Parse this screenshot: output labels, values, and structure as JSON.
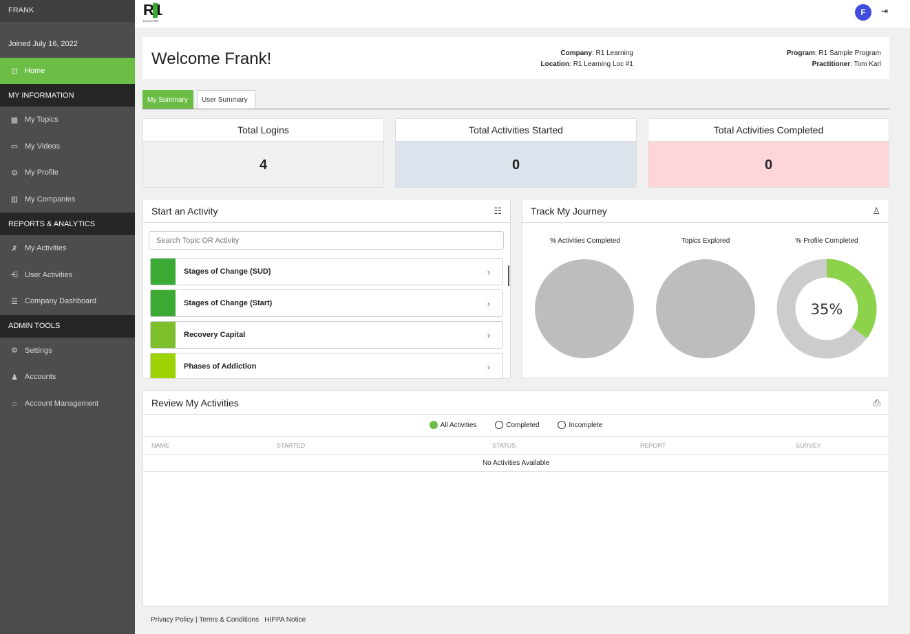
{
  "sidebar": {
    "user": "FRANK",
    "joined": "Joined July 16, 2022",
    "home": "Home",
    "sections": {
      "my_information": "MY INFORMATION",
      "reports": "REPORTS & ANALYTICS",
      "admin": "ADMIN TOOLS"
    },
    "items": {
      "my_topics": "My Topics",
      "my_videos": "My Videos",
      "my_profile": "My Profile",
      "my_companies": "My Companies",
      "my_activities": "My Activities",
      "user_activities": "User Activities",
      "company_dashboard": "Company Dashboard",
      "settings": "Settings",
      "accounts": "Accounts",
      "account_management": "Account Management"
    }
  },
  "topbar": {
    "logo_text": "R1",
    "logo_sub": "DISCOVER",
    "avatar_initial": "F"
  },
  "welcome": {
    "title": "Welcome Frank!",
    "company_label": "Company",
    "company_value": ": R1 Learning",
    "location_label": "Location",
    "location_value": ": R1 Learning Loc #1",
    "program_label": "Program",
    "program_value": ": R1 Sample Program",
    "practitioner_label": "Practitioner",
    "practitioner_value": ": Tom Karl"
  },
  "tabs": {
    "my_summary": "My Summary",
    "user_summary": "User Summary"
  },
  "stats": [
    {
      "title": "Total Logins",
      "value": "4",
      "bg": "#f0f0f0"
    },
    {
      "title": "Total Activities Started",
      "value": "0",
      "bg": "#dde3ec"
    },
    {
      "title": "Total Activities Completed",
      "value": "0",
      "bg": "#fdd5db"
    }
  ],
  "start_activity": {
    "title": "Start an Activity",
    "search_placeholder": "Search Topic OR Activity",
    "items": [
      {
        "name": "Stages of Change (SUD)",
        "color": "#3aaa35"
      },
      {
        "name": "Stages of Change (Start)",
        "color": "#3aaa35"
      },
      {
        "name": "Recovery Capital",
        "color": "#7dbf2a"
      },
      {
        "name": "Phases of Addiction",
        "color": "#9cd300"
      }
    ]
  },
  "journey": {
    "title": "Track My Journey",
    "labels": [
      "% Activities Completed",
      "Topics Explored",
      "% Profile Completed"
    ],
    "profile_percent_label": "35%",
    "profile_fraction": 0.35,
    "ring_color": "#8cd24a",
    "empty_color": "#bdbdbd"
  },
  "review": {
    "title": "Review My Activities",
    "filters": {
      "all": "All Activities",
      "completed": "Completed",
      "incomplete": "Incomplete"
    },
    "columns": [
      "NAME",
      "STARTED",
      "STATUS",
      "REPORT",
      "SURVEY"
    ],
    "empty": "No Activities Available"
  },
  "footer": {
    "privacy": "Privacy Policy",
    "sep": "|",
    "terms": "Terms & Conditions",
    "hippa": "HIPPA Notice"
  }
}
